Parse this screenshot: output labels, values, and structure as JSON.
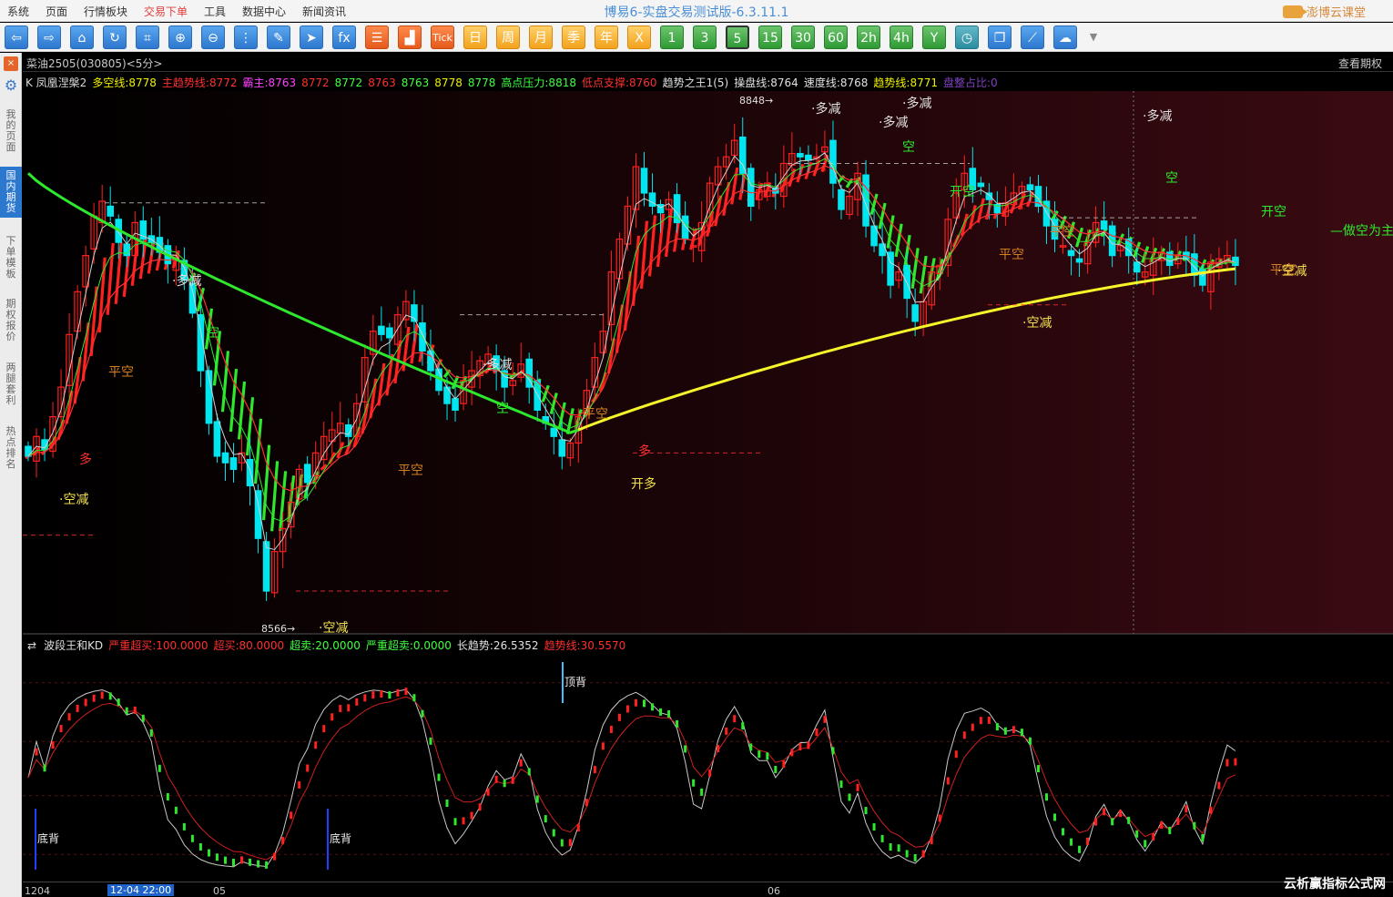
{
  "menu": [
    {
      "label": "系统",
      "active": false
    },
    {
      "label": "页面",
      "active": false
    },
    {
      "label": "行情板块",
      "active": false
    },
    {
      "label": "交易下单",
      "active": true
    },
    {
      "label": "工具",
      "active": false
    },
    {
      "label": "数据中心",
      "active": false
    },
    {
      "label": "新闻资讯",
      "active": false
    }
  ],
  "app_title": "博易6-实盘交易测试版-6.3.11.1",
  "brand": "澎博云课堂",
  "toolbar": {
    "buttons": [
      {
        "icon": "arrow-left-icon",
        "glyph": "⇦",
        "style": "blue"
      },
      {
        "icon": "arrow-right-icon",
        "glyph": "⇨",
        "style": "blue"
      },
      {
        "icon": "home-icon",
        "glyph": "⌂",
        "style": "blue"
      },
      {
        "icon": "refresh-icon",
        "glyph": "↻",
        "style": "blue"
      },
      {
        "icon": "crop-icon",
        "glyph": "⌗",
        "style": "blue"
      },
      {
        "icon": "zoom-in-icon",
        "glyph": "⊕",
        "style": "blue"
      },
      {
        "icon": "zoom-out-icon",
        "glyph": "⊖",
        "style": "blue"
      },
      {
        "icon": "formula-icon",
        "glyph": "⋮",
        "style": "blue"
      },
      {
        "icon": "pencil-icon",
        "glyph": "✎",
        "style": "blue"
      },
      {
        "icon": "cursor-icon",
        "glyph": "➤",
        "style": "blue"
      },
      {
        "icon": "fx-icon",
        "glyph": "fx",
        "style": "blue"
      },
      {
        "icon": "list-icon",
        "glyph": "☰",
        "style": "orange"
      },
      {
        "icon": "bar-chart-icon",
        "glyph": "▟",
        "style": "orange"
      },
      {
        "icon": "tick-icon",
        "glyph": "Tick",
        "style": "orange"
      },
      {
        "icon": "day-icon",
        "glyph": "日",
        "style": "yellow"
      },
      {
        "icon": "week-icon",
        "glyph": "周",
        "style": "yellow"
      },
      {
        "icon": "month-icon",
        "glyph": "月",
        "style": "yellow"
      },
      {
        "icon": "season-icon",
        "glyph": "季",
        "style": "yellow"
      },
      {
        "icon": "year-icon",
        "glyph": "年",
        "style": "yellow"
      },
      {
        "icon": "x-period-icon",
        "glyph": "X",
        "style": "yellow"
      },
      {
        "icon": "period-1-icon",
        "glyph": "1",
        "style": "green"
      },
      {
        "icon": "period-3-icon",
        "glyph": "3",
        "style": "green"
      },
      {
        "icon": "period-5-icon",
        "glyph": "5",
        "style": "greensel"
      },
      {
        "icon": "period-15-icon",
        "glyph": "15",
        "style": "green"
      },
      {
        "icon": "period-30-icon",
        "glyph": "30",
        "style": "green"
      },
      {
        "icon": "period-60-icon",
        "glyph": "60",
        "style": "green"
      },
      {
        "icon": "period-2h-icon",
        "glyph": "2h",
        "style": "green"
      },
      {
        "icon": "period-4h-icon",
        "glyph": "4h",
        "style": "green"
      },
      {
        "icon": "period-y-icon",
        "glyph": "Y",
        "style": "green"
      },
      {
        "icon": "clock-icon",
        "glyph": "◷",
        "style": "teal"
      },
      {
        "icon": "layers-icon",
        "glyph": "❐",
        "style": "blue"
      },
      {
        "icon": "draw-line-icon",
        "glyph": "⟋",
        "style": "blue"
      },
      {
        "icon": "cloud-upload-icon",
        "glyph": "☁",
        "style": "blue"
      },
      {
        "icon": "dropdown-icon",
        "glyph": "▼",
        "style": "drop"
      }
    ]
  },
  "leftbar": {
    "close": "×",
    "items": [
      {
        "label": "我的页面",
        "active": false
      },
      {
        "label": "国内期货",
        "active": true
      },
      {
        "label": "下单模板",
        "active": false
      },
      {
        "label": "期权报价",
        "active": false
      },
      {
        "label": "两腿套利",
        "active": false
      },
      {
        "label": "热点排名",
        "active": false
      }
    ]
  },
  "instrument": {
    "name": "菜油2505(030805)<5分>",
    "view_option": "查看期权"
  },
  "legend_main": [
    {
      "text": "K 凤凰涅槃2",
      "color": "#d8d8d8"
    },
    {
      "text": "多空线:8778",
      "color": "#f0f000"
    },
    {
      "text": "主趋势线:8772",
      "color": "#ff3030"
    },
    {
      "text": "霸主:8763",
      "color": "#ff40ff"
    },
    {
      "text": "8772",
      "color": "#ff3030"
    },
    {
      "text": "8772",
      "color": "#40ff40"
    },
    {
      "text": "8763",
      "color": "#ff3030"
    },
    {
      "text": "8763",
      "color": "#40ff40"
    },
    {
      "text": "8778",
      "color": "#f0f000"
    },
    {
      "text": "8778",
      "color": "#40ff40"
    },
    {
      "text": "高点压力:8818",
      "color": "#40ff40"
    },
    {
      "text": "低点支撑:8760",
      "color": "#ff3030"
    },
    {
      "text": "趋势之王1(5)",
      "color": "#e0e0e0"
    },
    {
      "text": "操盘线:8764",
      "color": "#e0e0e0"
    },
    {
      "text": "速度线:8768",
      "color": "#e0e0e0"
    },
    {
      "text": "趋势线:8771",
      "color": "#f0f000"
    },
    {
      "text": "盘整占比:0",
      "color": "#8040c0"
    }
  ],
  "legend_sub": [
    {
      "text": "波段王和KD",
      "color": "#e0e0e0"
    },
    {
      "text": "严重超买:100.0000",
      "color": "#ff3030"
    },
    {
      "text": "超买:80.0000",
      "color": "#ff3030"
    },
    {
      "text": "超卖:20.0000",
      "color": "#40ff40"
    },
    {
      "text": "严重超卖:0.0000",
      "color": "#40ff40"
    },
    {
      "text": "长趋势:26.5352",
      "color": "#e0e0e0"
    },
    {
      "text": "趋势线:30.5570",
      "color": "#ff3030"
    }
  ],
  "colors": {
    "up": "#ff2020",
    "down": "#00e5ee",
    "ma_green": "#2ee82e",
    "ma_yellow": "#f5f52a",
    "white_line": "#d0d0d0",
    "red_line": "#ff3030",
    "signal_text": "#f0e050"
  },
  "chart_data": [
    {
      "type": "candlestick",
      "title": "菜油2505(030805)<5分>",
      "ylim": [
        8540,
        8870
      ],
      "price_labels": {
        "high": "8848",
        "low": "8566"
      },
      "closes": [
        8648,
        8660,
        8652,
        8672,
        8690,
        8722,
        8748,
        8770,
        8794,
        8803,
        8794,
        8778,
        8770,
        8790,
        8780,
        8778,
        8772,
        8765,
        8770,
        8755,
        8735,
        8700,
        8668,
        8648,
        8644,
        8640,
        8650,
        8630,
        8598,
        8566,
        8590,
        8604,
        8620,
        8640,
        8632,
        8650,
        8660,
        8664,
        8668,
        8660,
        8680,
        8708,
        8724,
        8722,
        8720,
        8734,
        8742,
        8730,
        8712,
        8700,
        8688,
        8680,
        8676,
        8694,
        8700,
        8706,
        8710,
        8700,
        8690,
        8694,
        8704,
        8690,
        8676,
        8668,
        8660,
        8648,
        8656,
        8672,
        8688,
        8708,
        8724,
        8760,
        8780,
        8800,
        8824,
        8808,
        8800,
        8796,
        8804,
        8790,
        8780,
        8776,
        8790,
        8814,
        8824,
        8830,
        8840,
        8820,
        8800,
        8810,
        8814,
        8808,
        8826,
        8832,
        8830,
        8828,
        8830,
        8836,
        8814,
        8798,
        8806,
        8820,
        8788,
        8776,
        8770,
        8752,
        8760,
        8744,
        8730,
        8742,
        8760,
        8764,
        8792,
        8808,
        8820,
        8810,
        8812,
        8804,
        8796,
        8802,
        8808,
        8812,
        8810,
        8800,
        8788,
        8780,
        8776,
        8770,
        8766,
        8778,
        8790,
        8786,
        8770,
        8776,
        8770,
        8760,
        8760,
        8768,
        8772,
        8764,
        8770,
        8768,
        8758,
        8752,
        8766,
        8768,
        8770,
        8764
      ],
      "annotations": [
        {
          "text": "·空减",
          "color": "#f0e050"
        },
        {
          "text": "·多减",
          "color": "#e0e0e0"
        },
        {
          "text": "平空",
          "color": "#d08020"
        },
        {
          "text": "空",
          "color": "#2ee82e"
        },
        {
          "text": "多",
          "color": "#ff3030"
        },
        {
          "text": "8566→",
          "color": "#e0e0e0"
        },
        {
          "text": "·空减",
          "color": "#f0e050"
        },
        {
          "text": "平空",
          "color": "#d08020"
        },
        {
          "text": "·多减",
          "color": "#e0e0e0"
        },
        {
          "text": "空",
          "color": "#2ee82e"
        },
        {
          "text": "平空",
          "color": "#d08020"
        },
        {
          "text": "开多",
          "color": "#f0e050"
        },
        {
          "text": "多",
          "color": "#ff3030"
        },
        {
          "text": "8848→",
          "color": "#e0e0e0"
        },
        {
          "text": "·多减",
          "color": "#e0e0e0"
        },
        {
          "text": "·多减",
          "color": "#e0e0e0"
        },
        {
          "text": "·多减",
          "color": "#e0e0e0"
        },
        {
          "text": "空",
          "color": "#2ee82e"
        },
        {
          "text": "开空",
          "color": "#2ee82e"
        },
        {
          "text": "平空",
          "color": "#d08020"
        },
        {
          "text": "·空减",
          "color": "#f0e050"
        },
        {
          "text": "平空",
          "color": "#d08020"
        },
        {
          "text": "·多减",
          "color": "#e0e0e0"
        },
        {
          "text": "空",
          "color": "#2ee82e"
        },
        {
          "text": "开空",
          "color": "#2ee82e"
        },
        {
          "text": "平空",
          "color": "#d08020"
        },
        {
          "text": "·空减",
          "color": "#f0e050"
        },
        {
          "text": "—做空为主",
          "color": "#2ee82e"
        }
      ]
    },
    {
      "type": "line",
      "title": "波段王和KD",
      "ylim": [
        0,
        100
      ],
      "labels": {
        "bottom_div": "底背",
        "top_div": "顶背"
      }
    }
  ],
  "date_axis": {
    "labels": [
      "1204",
      "05",
      "06"
    ],
    "cursor": "12-04 22:00"
  },
  "watermark": "云析赢指标公式网"
}
